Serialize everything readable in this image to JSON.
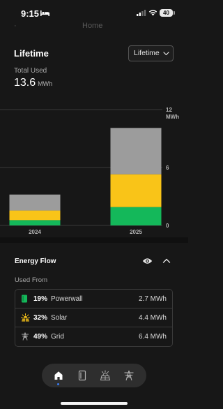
{
  "status_bar": {
    "time": "9:15",
    "battery": "40"
  },
  "peek": {
    "left": "·",
    "text": "Home"
  },
  "lifetime": {
    "title": "Lifetime",
    "range_label": "Lifetime",
    "total_label": "Total Used",
    "total_value": "13.6",
    "total_unit": "MWh"
  },
  "chart_data": {
    "type": "bar",
    "stacked": true,
    "categories": [
      "2024",
      "2025"
    ],
    "series": [
      {
        "name": "Powerwall",
        "color": "#14b85a",
        "values": [
          0.55,
          1.9
        ]
      },
      {
        "name": "Solar",
        "color": "#f9c418",
        "values": [
          1.0,
          3.4
        ]
      },
      {
        "name": "Grid",
        "color": "#9c9c9c",
        "values": [
          1.65,
          4.8
        ]
      }
    ],
    "yticks": [
      "0",
      "6",
      "12"
    ],
    "yunit": "MWh",
    "ylim": [
      0,
      12
    ],
    "grid": true
  },
  "energy_flow": {
    "title": "Energy Flow",
    "used_from_label": "Used From",
    "rows": [
      {
        "pct": "19%",
        "name": "Powerwall",
        "value": "2.7 MWh",
        "icon": "powerwall-icon",
        "color": "#14b85a"
      },
      {
        "pct": "32%",
        "name": "Solar",
        "value": "4.4 MWh",
        "icon": "solar-icon",
        "color": "#f9c418"
      },
      {
        "pct": "49%",
        "name": "Grid",
        "value": "6.4 MWh",
        "icon": "grid-tower-icon",
        "color": "#a0a0a0"
      }
    ]
  },
  "nav": {
    "items": [
      "home-icon",
      "powerwall-icon",
      "solar-panel-icon",
      "grid-tower-icon"
    ],
    "active": "home-icon"
  }
}
